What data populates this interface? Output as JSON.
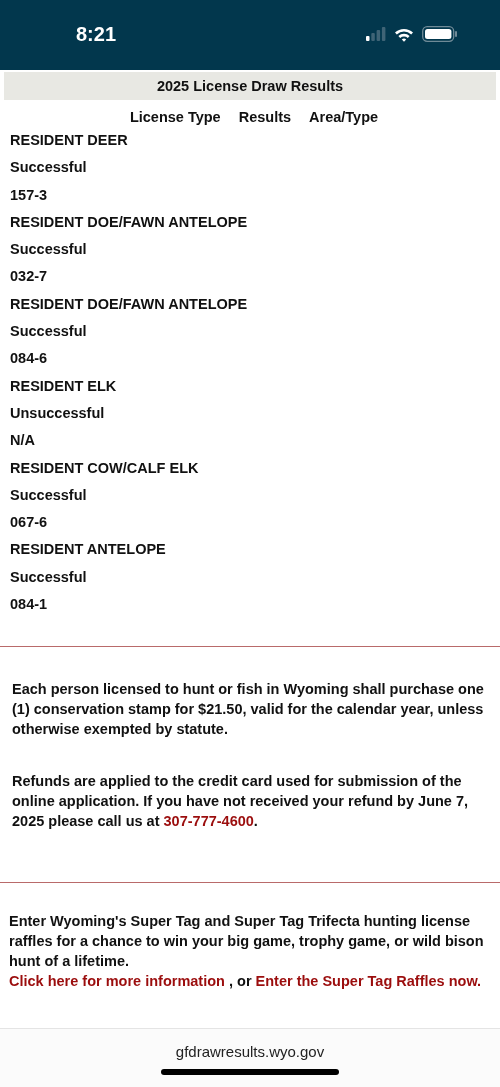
{
  "status_bar": {
    "time": "8:21"
  },
  "title": "2025 License Draw Results",
  "columns": [
    "License Type",
    "Results",
    "Area/Type"
  ],
  "results": [
    {
      "license_type": "RESIDENT DEER",
      "result": "Successful",
      "area": "157-3"
    },
    {
      "license_type": "RESIDENT DOE/FAWN ANTELOPE",
      "result": "Successful",
      "area": "032-7"
    },
    {
      "license_type": "RESIDENT DOE/FAWN ANTELOPE",
      "result": "Successful",
      "area": "084-6"
    },
    {
      "license_type": "RESIDENT ELK",
      "result": "Unsuccessful",
      "area": "N/A"
    },
    {
      "license_type": "RESIDENT COW/CALF ELK",
      "result": "Successful",
      "area": "067-6"
    },
    {
      "license_type": "RESIDENT ANTELOPE",
      "result": "Successful",
      "area": "084-1"
    }
  ],
  "notices": [
    {
      "text": "Each person licensed to hunt or fish in Wyoming shall purchase one (1) conservation stamp for $21.50, valid for the calendar year, unless otherwise exempted by statute."
    },
    {
      "text": "Refunds are applied to the credit card used for submission of the online application. If you have not received your refund by June 7, 2025 please call us at",
      "link": "307-777-4600",
      "after": "."
    }
  ],
  "raffle": {
    "text": "Enter Wyoming's Super Tag and Super Tag Trifecta hunting license raffles for a chance to win your big game, trophy game, or wild bison hunt of a lifetime.",
    "links": [
      "Click here for more information",
      "Enter the Super Tag Raffles now."
    ],
    "separator": ", or"
  },
  "footer": {
    "url": "gfdrawresults.wyo.gov"
  }
}
